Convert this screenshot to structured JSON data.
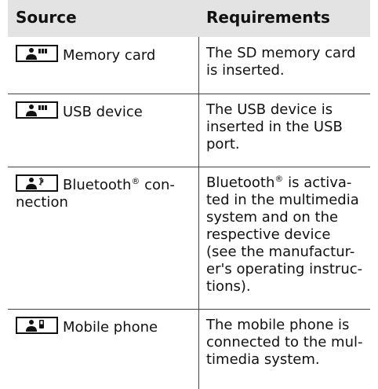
{
  "header": {
    "source": "Source",
    "requirements": "Requirements"
  },
  "rows": [
    {
      "icon": "media-user-card-icon",
      "source": "Memory card",
      "requirements": [
        "The SD memory card",
        "is inserted."
      ]
    },
    {
      "icon": "media-user-usb-icon",
      "source": "USB device",
      "requirements": [
        "The USB device is",
        "inserted in the USB",
        "port."
      ]
    },
    {
      "icon": "media-user-bluetooth-icon",
      "source_lines": [
        "Bluetooth",
        "®",
        " con-",
        "nection"
      ],
      "requirements_bt": {
        "line1a": "Bluetooth",
        "reg": "®",
        "line1b": " is activa-",
        "rest": [
          "ted in the multimedia",
          "system and on the",
          "respective device",
          "(see the manufactur-",
          "er's operating instruc-",
          "tions)."
        ]
      }
    },
    {
      "icon": "media-user-phone-icon",
      "source": "Mobile phone",
      "requirements": [
        "The mobile phone is",
        "connected to the mul-",
        "timedia system."
      ]
    }
  ]
}
